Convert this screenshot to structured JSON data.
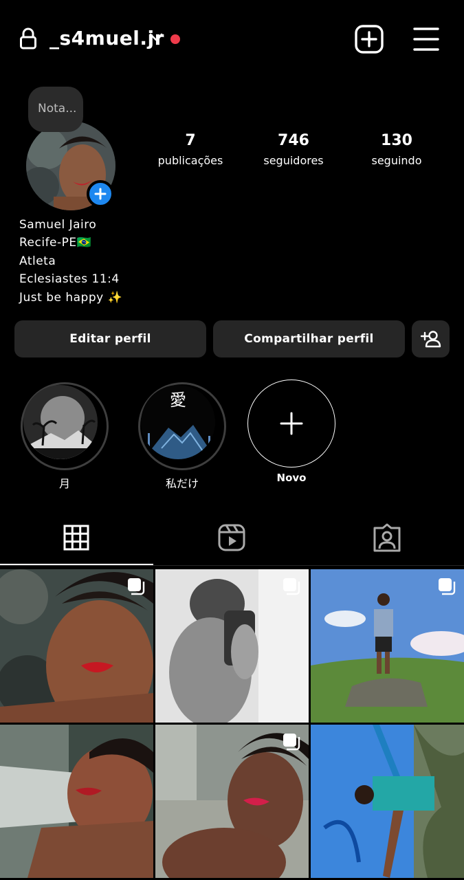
{
  "header": {
    "username": "_s4muel.jr"
  },
  "note": {
    "placeholder": "Nota..."
  },
  "stats": [
    {
      "value": "7",
      "label": "publicações"
    },
    {
      "value": "746",
      "label": "seguidores"
    },
    {
      "value": "130",
      "label": "seguindo"
    }
  ],
  "bio": {
    "name": "Samuel Jairo",
    "lines": [
      "Recife-PE🇧🇷",
      "Atleta",
      "Eclesiastes 11:4",
      "Just be happy ✨"
    ]
  },
  "actions": {
    "edit_profile": "Editar perfil",
    "share_profile": "Compartilhar perfil"
  },
  "highlights": [
    {
      "label": "月"
    },
    {
      "label": "私だけ",
      "badge_text": "愛"
    },
    {
      "label": "Novo"
    }
  ],
  "colors": {
    "accent_blue": "#1e88f0",
    "notification_red": "#ef3b4b",
    "button_bg": "#262626"
  }
}
